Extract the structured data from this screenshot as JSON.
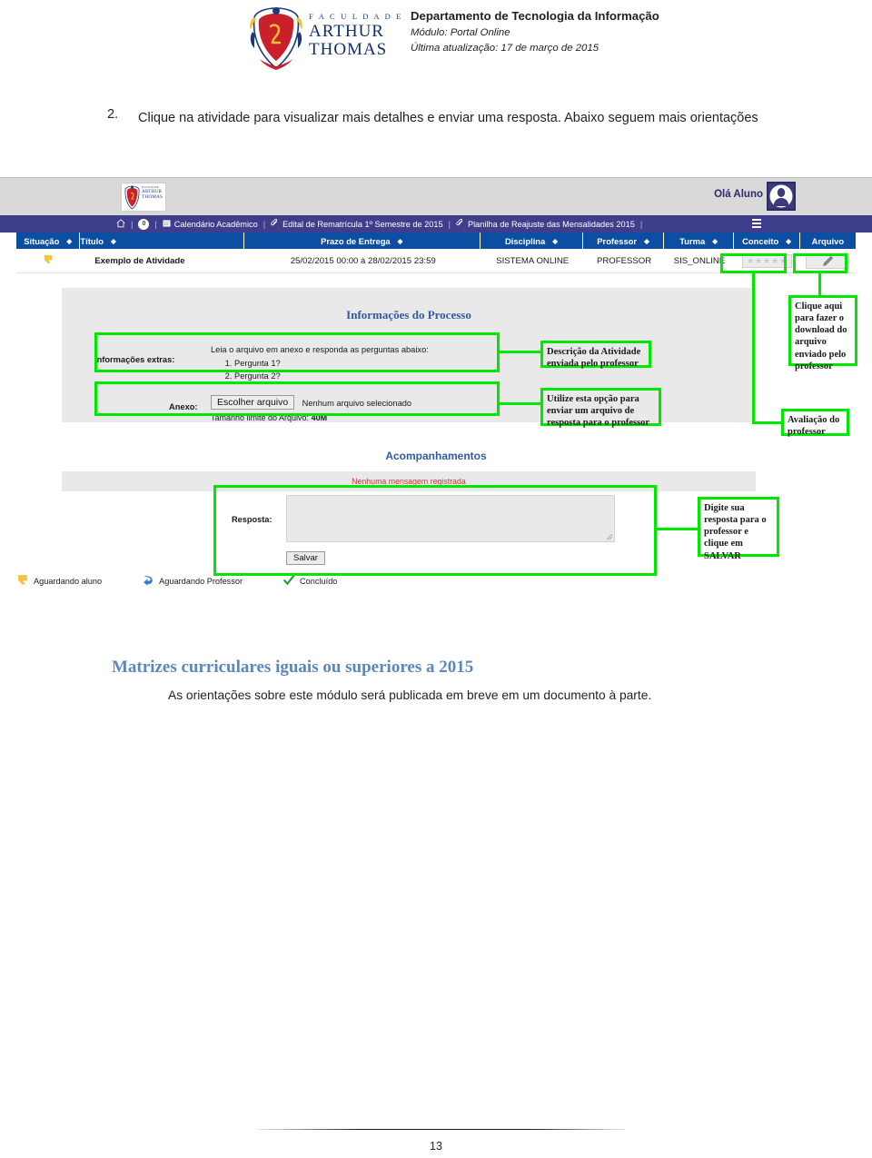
{
  "document_header": {
    "institution_lines": [
      "F A C U L D A D E",
      "ARTHUR",
      "THOMAS"
    ],
    "department": "Departamento de Tecnologia da Informação",
    "module": "Módulo: Portal Online",
    "last_update": "Última atualização: 17 de março de 2015"
  },
  "instruction": {
    "number": "2.",
    "text": "Clique na atividade para visualizar mais detalhes e enviar uma resposta. Abaixo seguem mais orientações"
  },
  "screenshot": {
    "topbar": {
      "greeting": "Olá Aluno",
      "logo_lines": [
        "FACULDADE",
        "ARTHUR",
        "THOMAS"
      ]
    },
    "navbar": {
      "badge_count": "0",
      "items": [
        {
          "label": "Calendário Acadêmico",
          "icon": "calendar-icon"
        },
        {
          "label": "Edital de Rematrícula 1º Semestre de 2015",
          "icon": "paperclip-icon"
        },
        {
          "label": "Planilha de Reajuste das Mensalidades 2015",
          "icon": "paperclip-icon"
        }
      ],
      "separator": "|"
    },
    "table": {
      "columns": [
        "Situação",
        "Título",
        "Prazo de Entrega",
        "Disciplina",
        "Professor",
        "Turma",
        "Conceito",
        "Arquivo"
      ],
      "row": {
        "situacao_icon": "pointing-hand-icon",
        "titulo": "Exemplo de Atividade",
        "prazo": "25/02/2015 00:00 à 28/02/2015 23:59",
        "disciplina": "SISTEMA ONLINE",
        "professor": "PROFESSOR",
        "turma": "SIS_ONLINE",
        "conceito_stars": "★★★★★",
        "arquivo_icon": "pencil-icon"
      }
    },
    "process_panel": {
      "title": "Informações do Processo",
      "extras_label": "Informações extras:",
      "extras_intro": "Leia o arquivo em anexo e responda as perguntas abaixo:",
      "extras_items": [
        "Pergunta 1?",
        "Pergunta 2?"
      ],
      "anexo_label": "Anexo:",
      "file_button": "Escolher arquivo",
      "file_status": "Nenhum arquivo selecionado",
      "size_note_prefix": "Tamanho limite do Arquivo: ",
      "size_note_value": "40M"
    },
    "followups": {
      "title": "Acompanhamentos",
      "empty_message": "Nenhuma mensagem registrada",
      "response_label": "Resposta:",
      "response_value": "",
      "save_button": "Salvar"
    },
    "legend": [
      {
        "label": "Aguardando aluno",
        "icon": "pointing-hand-icon",
        "color": "#f5c242"
      },
      {
        "label": "Aguardando Professor",
        "icon": "reply-arrow-icon",
        "color": "#2f7fd0"
      },
      {
        "label": "Concluído",
        "icon": "check-icon",
        "color": "#1f9d2f"
      }
    ],
    "annotations": [
      {
        "id": "descricao",
        "text": "Descrição da Atividade enviada pelo professor"
      },
      {
        "id": "upload",
        "text": "Utilize esta opção para enviar um arquivo de resposta para o professor"
      },
      {
        "id": "download",
        "text": "Clique aqui para fazer o download do arquivo enviado pelo professor"
      },
      {
        "id": "avaliacao",
        "text": "Avaliação do professor"
      },
      {
        "id": "salvar",
        "text": "Digite sua resposta para o professor e clique em SALVAR"
      }
    ],
    "highlight_color": "#00e800"
  },
  "section": {
    "title": "Matrizes curriculares iguais ou superiores a 2015",
    "body": "As orientações sobre este módulo será publicada em breve em um documento à parte."
  },
  "footer": {
    "page_number": "13"
  }
}
